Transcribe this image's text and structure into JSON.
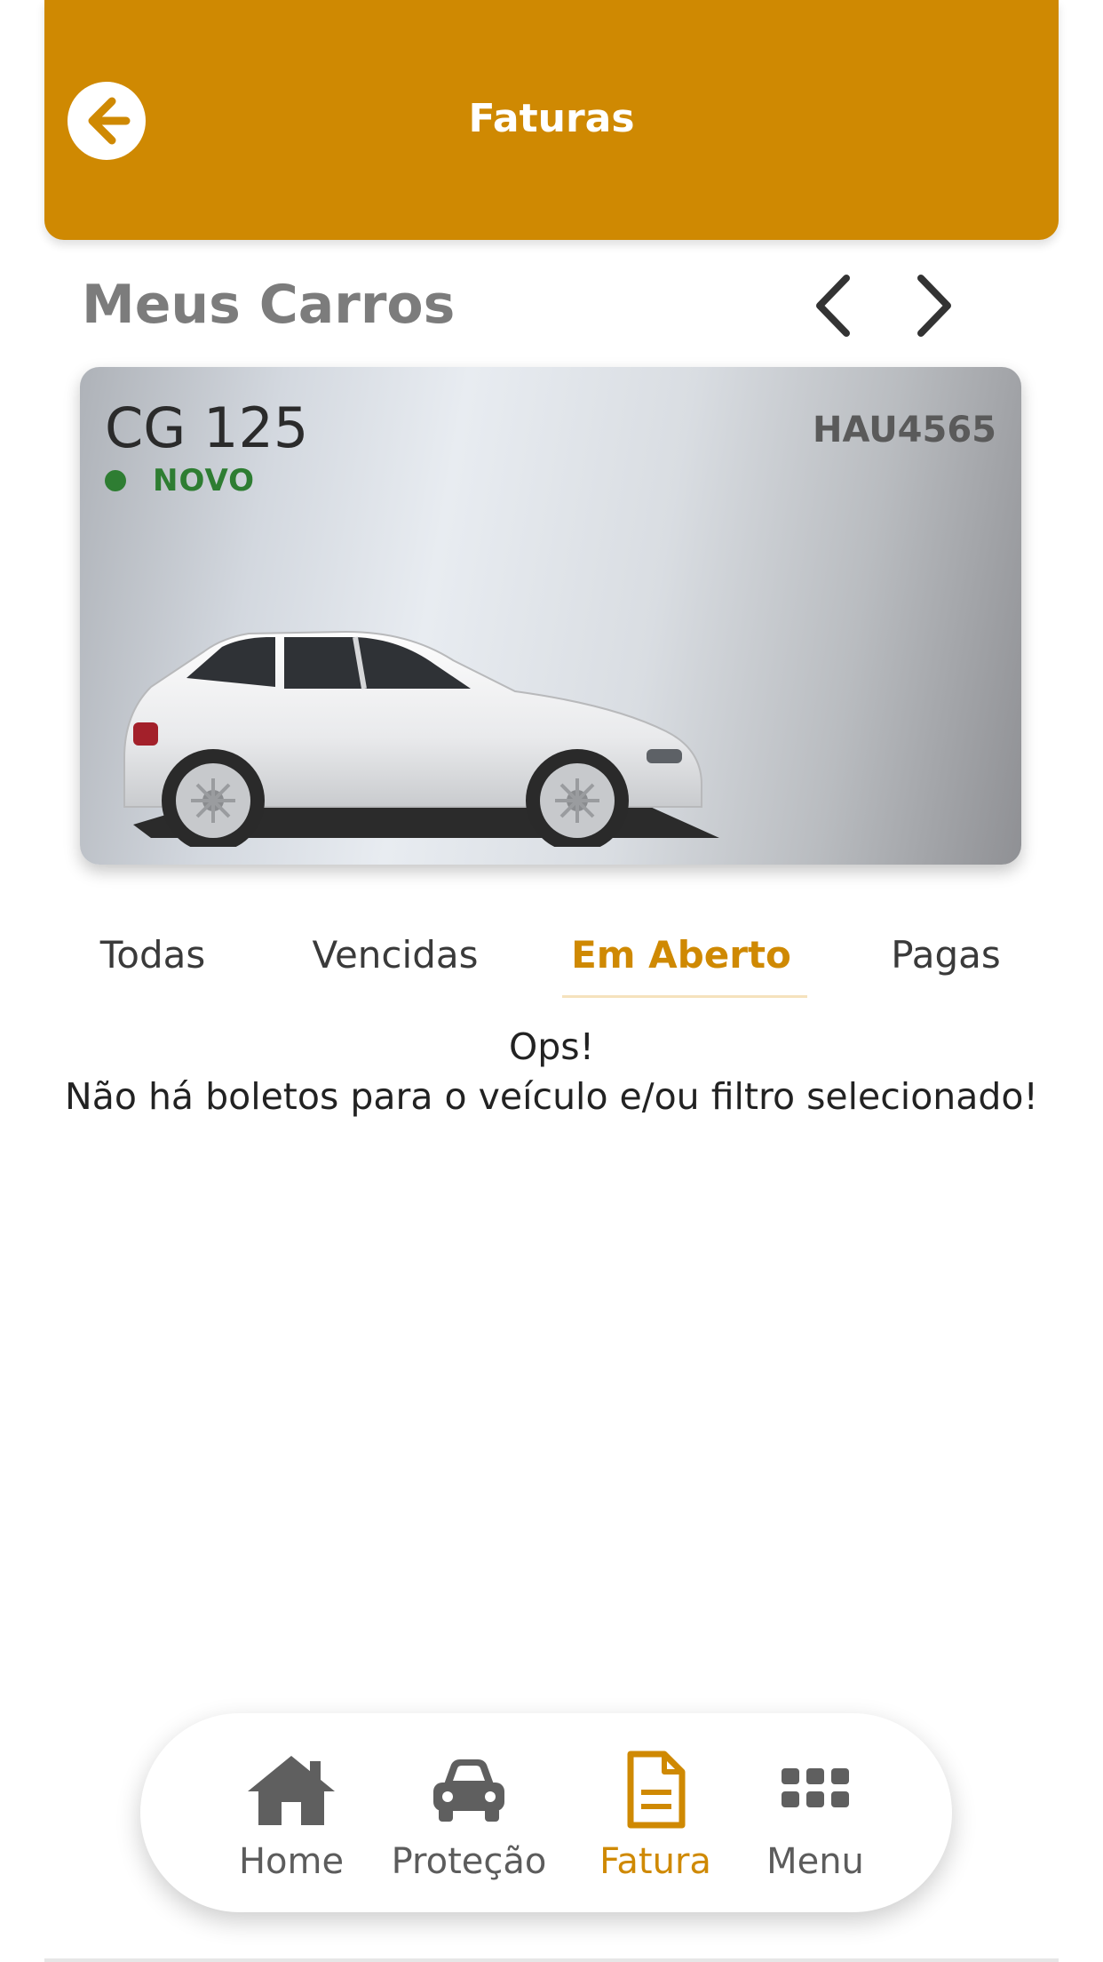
{
  "header": {
    "title": "Faturas",
    "accent_color": "#cf8902"
  },
  "cars_section": {
    "title": "Meus Carros",
    "prev_icon": "chevron-left-icon",
    "next_icon": "chevron-right-icon"
  },
  "car": {
    "model": "CG 125",
    "plate": "HAU4565",
    "status": "NOVO",
    "status_color": "#2e7d32"
  },
  "tabs": [
    {
      "label": "Todas",
      "active": false
    },
    {
      "label": "Vencidas",
      "active": false
    },
    {
      "label": "Em Aberto",
      "active": true
    },
    {
      "label": "Pagas",
      "active": false
    }
  ],
  "empty_state": {
    "line1": "Ops!",
    "line2": "Não há boletos para o veículo e/ou filtro selecionado!"
  },
  "bottom_nav": [
    {
      "label": "Home",
      "icon": "home-icon",
      "active": false
    },
    {
      "label": "Proteção",
      "icon": "car-icon",
      "active": false
    },
    {
      "label": "Fatura",
      "icon": "document-icon",
      "active": true
    },
    {
      "label": "Menu",
      "icon": "grid-icon",
      "active": false
    }
  ]
}
